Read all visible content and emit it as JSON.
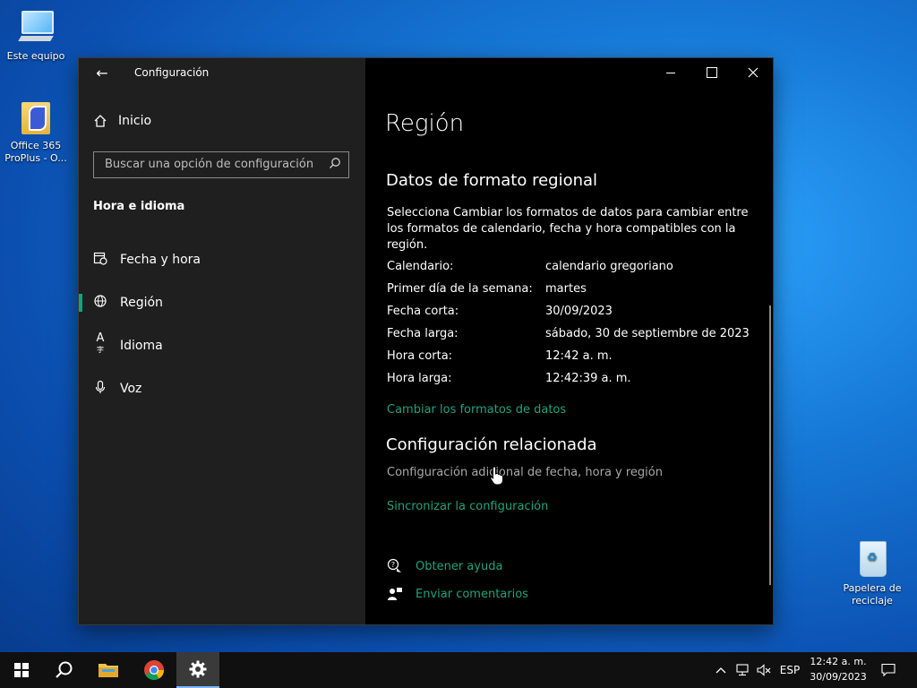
{
  "desktop": {
    "icons": [
      {
        "label": "Este equipo"
      },
      {
        "label": "Office 365 ProPlus - O..."
      },
      {
        "label": "Papelera de reciclaje"
      }
    ]
  },
  "window": {
    "title": "Configuración",
    "sidebar": {
      "home": "Inicio",
      "search_placeholder": "Buscar una opción de configuración",
      "section": "Hora e idioma",
      "items": [
        {
          "label": "Fecha y hora",
          "icon": "date-time-icon"
        },
        {
          "label": "Región",
          "icon": "globe-icon",
          "active": true
        },
        {
          "label": "Idioma",
          "icon": "language-icon"
        },
        {
          "label": "Voz",
          "icon": "microphone-icon"
        }
      ]
    },
    "content": {
      "title": "Región",
      "regional_heading": "Datos de formato regional",
      "regional_desc": "Selecciona Cambiar los formatos de datos para cambiar entre los formatos de calendario, fecha y hora compatibles con la región.",
      "rows": [
        {
          "label": "Calendario:",
          "value": "calendario gregoriano"
        },
        {
          "label": "Primer día de la semana:",
          "value": "martes"
        },
        {
          "label": "Fecha corta:",
          "value": "30/09/2023"
        },
        {
          "label": "Fecha larga:",
          "value": "sábado, 30 de septiembre de 2023"
        },
        {
          "label": "Hora corta:",
          "value": "12:42 a. m."
        },
        {
          "label": "Hora larga:",
          "value": "12:42:39 a. m."
        }
      ],
      "change_formats_link": "Cambiar los formatos de datos",
      "related_heading": "Configuración relacionada",
      "related_link": "Configuración adicional de fecha, hora y región",
      "sync_link": "Sincronizar la configuración",
      "help_link": "Obtener ayuda",
      "feedback_link": "Enviar comentarios"
    },
    "accent_color": "#1fa37f"
  },
  "taskbar": {
    "language": "ESP",
    "time": "12:42 a. m.",
    "date": "30/09/2023"
  }
}
